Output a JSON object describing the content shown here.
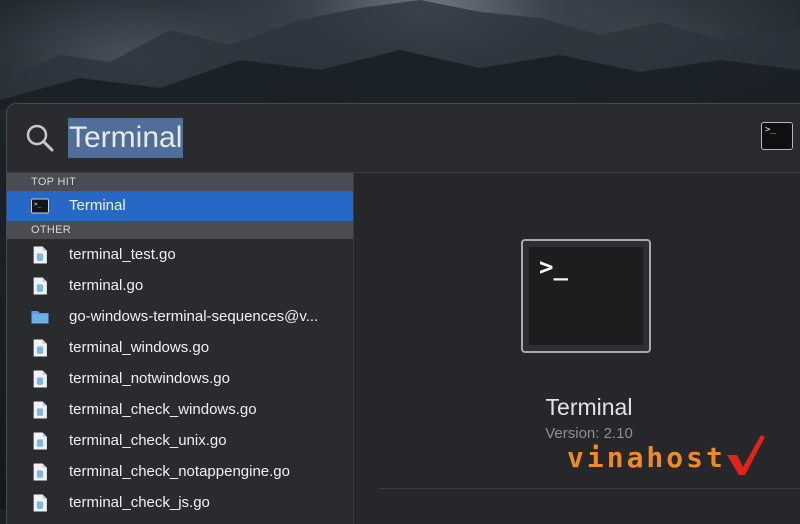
{
  "search": {
    "query": "Terminal"
  },
  "results": {
    "sections": [
      {
        "title": "TOP HIT",
        "items": [
          {
            "label": "Terminal",
            "icon": "terminal-app-icon",
            "selected": true
          }
        ]
      },
      {
        "title": "OTHER",
        "items": [
          {
            "label": "terminal_test.go",
            "icon": "go-file-icon"
          },
          {
            "label": "terminal.go",
            "icon": "go-file-icon"
          },
          {
            "label": "go-windows-terminal-sequences@v...",
            "icon": "folder-icon"
          },
          {
            "label": "terminal_windows.go",
            "icon": "go-file-icon"
          },
          {
            "label": "terminal_notwindows.go",
            "icon": "go-file-icon"
          },
          {
            "label": "terminal_check_windows.go",
            "icon": "go-file-icon"
          },
          {
            "label": "terminal_check_unix.go",
            "icon": "go-file-icon"
          },
          {
            "label": "terminal_check_notappengine.go",
            "icon": "go-file-icon"
          },
          {
            "label": "terminal_check_js.go",
            "icon": "go-file-icon"
          }
        ]
      }
    ]
  },
  "preview": {
    "icon_prompt": ">_",
    "app_name": "Terminal",
    "version": "Version: 2.10"
  },
  "watermark": {
    "text": "vinahost"
  },
  "colors": {
    "selection": "#2568c6",
    "panel": "#26272b",
    "watermark": "#f08a24"
  }
}
